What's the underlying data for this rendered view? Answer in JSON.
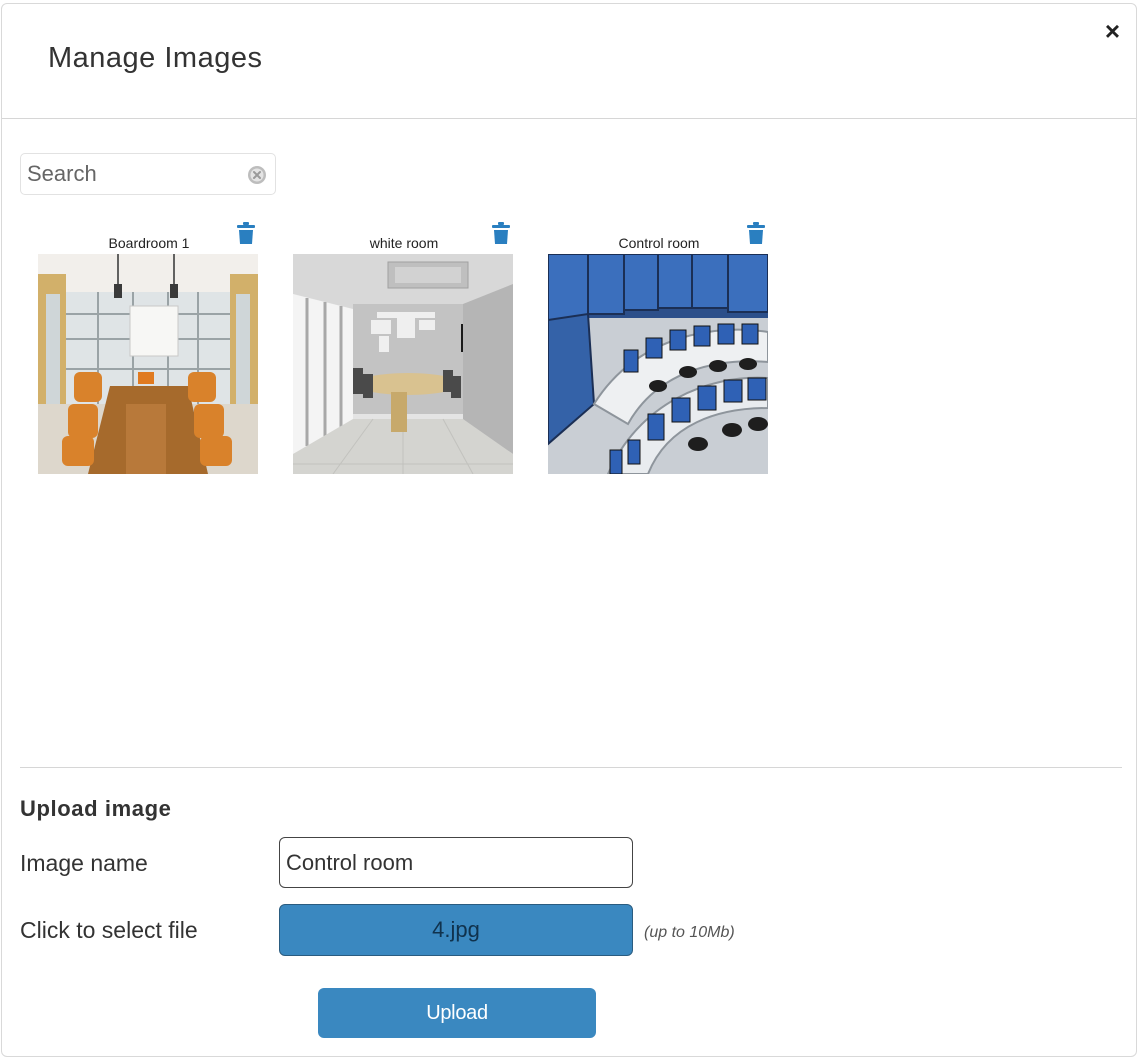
{
  "modal": {
    "title": "Manage Images",
    "close_label": "×"
  },
  "search": {
    "placeholder": "Search"
  },
  "images": [
    {
      "name": "Boardroom 1",
      "thumbnail": "boardroom-photo"
    },
    {
      "name": "white room",
      "thumbnail": "white-room-photo"
    },
    {
      "name": "Control room",
      "thumbnail": "control-room-photo"
    }
  ],
  "upload": {
    "heading": "Upload image",
    "name_label": "Image name",
    "name_value": "Control room",
    "file_label": "Click to select file",
    "file_value": "4.jpg",
    "file_hint": "(up to 10Mb)",
    "submit_label": "Upload"
  },
  "colors": {
    "primary": "#3a88c0",
    "icon_blue": "#2a7fc0"
  },
  "icons": {
    "close": "close-icon",
    "clear": "clear-search-icon",
    "delete": "trash-icon"
  }
}
